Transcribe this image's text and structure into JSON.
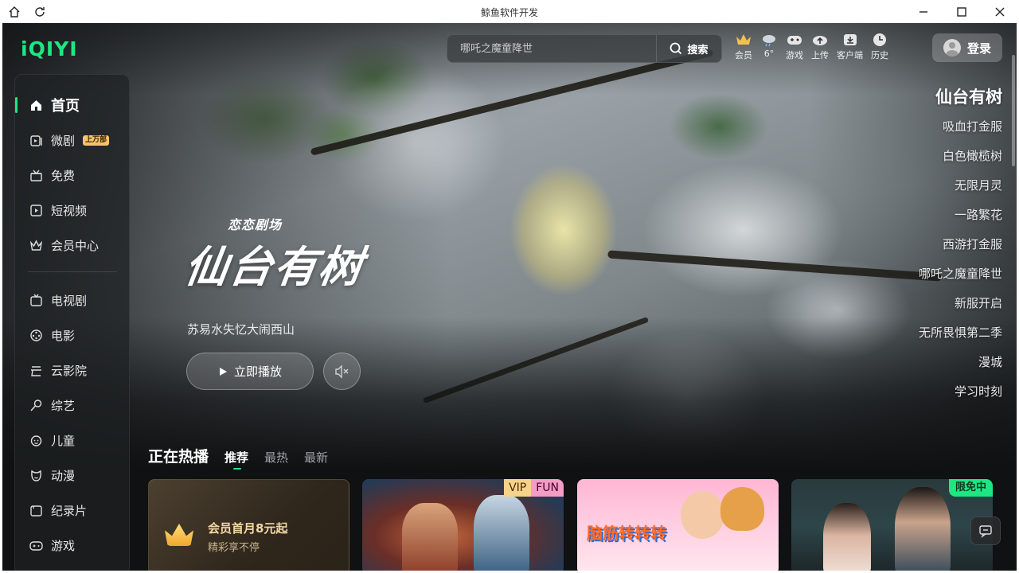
{
  "window": {
    "title": "鲸鱼软件开发"
  },
  "logo": {
    "text": "iQIYI"
  },
  "search": {
    "placeholder": "哪吒之魔童降世",
    "button_label": "搜索"
  },
  "top_icons": [
    {
      "label": "会员",
      "icon": "crown-icon"
    },
    {
      "label": "6°",
      "icon": "weather-icon"
    },
    {
      "label": "游戏",
      "icon": "gamepad-icon"
    },
    {
      "label": "上传",
      "icon": "upload-icon"
    },
    {
      "label": "客户端",
      "icon": "download-icon"
    },
    {
      "label": "历史",
      "icon": "clock-icon"
    }
  ],
  "login": {
    "label": "登录"
  },
  "sidebar": {
    "items": [
      {
        "label": "首页",
        "icon": "home-icon",
        "active": true
      },
      {
        "label": "微剧",
        "icon": "micro-drama-icon",
        "badge": "上万部"
      },
      {
        "label": "免费",
        "icon": "gift-icon"
      },
      {
        "label": "短视频",
        "icon": "short-video-icon"
      },
      {
        "label": "会员中心",
        "icon": "vip-crown-icon"
      },
      {
        "label": "电视剧",
        "icon": "tv-icon"
      },
      {
        "label": "电影",
        "icon": "film-reel-icon"
      },
      {
        "label": "云影院",
        "icon": "cloud-cinema-icon"
      },
      {
        "label": "综艺",
        "icon": "microphone-icon"
      },
      {
        "label": "儿童",
        "icon": "child-face-icon"
      },
      {
        "label": "动漫",
        "icon": "anime-icon"
      },
      {
        "label": "纪录片",
        "icon": "camera-icon"
      },
      {
        "label": "游戏",
        "icon": "game-controller-icon"
      }
    ]
  },
  "hero": {
    "brand_tag": "恋恋剧场",
    "title": "仙台有树",
    "subtitle": "苏易水失忆大闹西山",
    "play_label": "立即播放"
  },
  "right_list": {
    "items": [
      "仙台有树",
      "吸血打金服",
      "白色橄榄树",
      "无限月灵",
      "一路繁花",
      "西游打金服",
      "哪吒之魔童降世",
      "新服开启",
      "无所畏惧第二季",
      "漫城",
      "学习时刻"
    ],
    "active_index": 0
  },
  "hot": {
    "title": "正在热播",
    "tabs": [
      "推荐",
      "最热",
      "最新"
    ],
    "active_tab": 0,
    "cards": [
      {
        "kind": "promo",
        "title": "会员首月8元起",
        "subtitle": "精彩享不停"
      },
      {
        "kind": "poster",
        "tags": [
          "VIP",
          "FUN"
        ]
      },
      {
        "kind": "poster",
        "title_art": "脑筋转转转"
      },
      {
        "kind": "poster",
        "tags": [
          "限免中"
        ]
      }
    ]
  },
  "colors": {
    "accent": "#1ce783",
    "background": "#0f1112"
  }
}
